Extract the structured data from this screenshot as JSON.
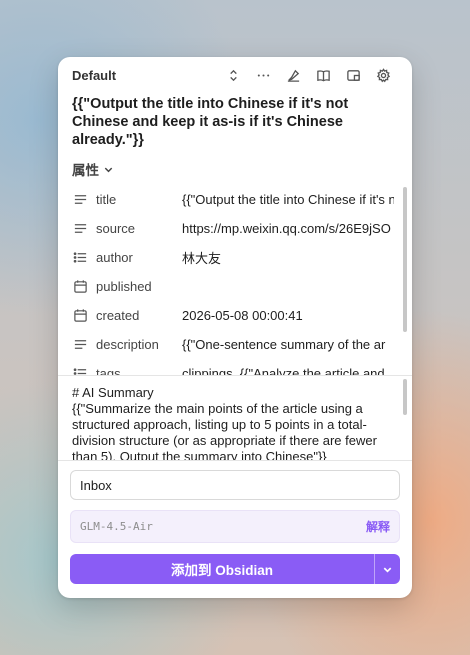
{
  "header": {
    "vault_name": "Default",
    "icons": [
      "chevron-up-down-icon",
      "more-icon",
      "highlighter-icon",
      "reader-icon",
      "sidepanel-icon",
      "settings-icon"
    ]
  },
  "note": {
    "title": "{{\"Output the title into Chinese if it's not Chinese and keep it as-is if it's Chinese already.\"}}"
  },
  "properties": {
    "toggle_label": "属性",
    "rows": [
      {
        "icon": "text-lines-icon",
        "key": "title",
        "value": "{{\"Output the title into Chinese if it's not"
      },
      {
        "icon": "text-lines-icon",
        "key": "source",
        "value": "https://mp.weixin.qq.com/s/26E9jSO"
      },
      {
        "icon": "list-icon",
        "key": "author",
        "value": "林大友"
      },
      {
        "icon": "calendar-icon",
        "key": "published",
        "value": ""
      },
      {
        "icon": "calendar-icon",
        "key": "created",
        "value": "2026-05-08 00:00:41"
      },
      {
        "icon": "text-lines-icon",
        "key": "description",
        "value": "{{\"One-sentence summary of the ar"
      },
      {
        "icon": "list-icon",
        "key": "tags",
        "value": "clippings, {{\"Analyze the article and"
      }
    ]
  },
  "content": {
    "text": "# AI Summary\n{{\"Summarize the main points of the article using a structured approach, listing up to 5 points in a total-division structure (or as appropriate if there are fewer than 5). Output the summary into Chinese\"}}"
  },
  "folder": {
    "value": "Inbox"
  },
  "interpreter": {
    "model": "GLM-4.5-Air",
    "button_label": "解释"
  },
  "actions": {
    "add_label": "添加到 Obsidian"
  },
  "colors": {
    "accent": "#8a5cf5",
    "interpreter_bg": "#f4f0fc"
  }
}
